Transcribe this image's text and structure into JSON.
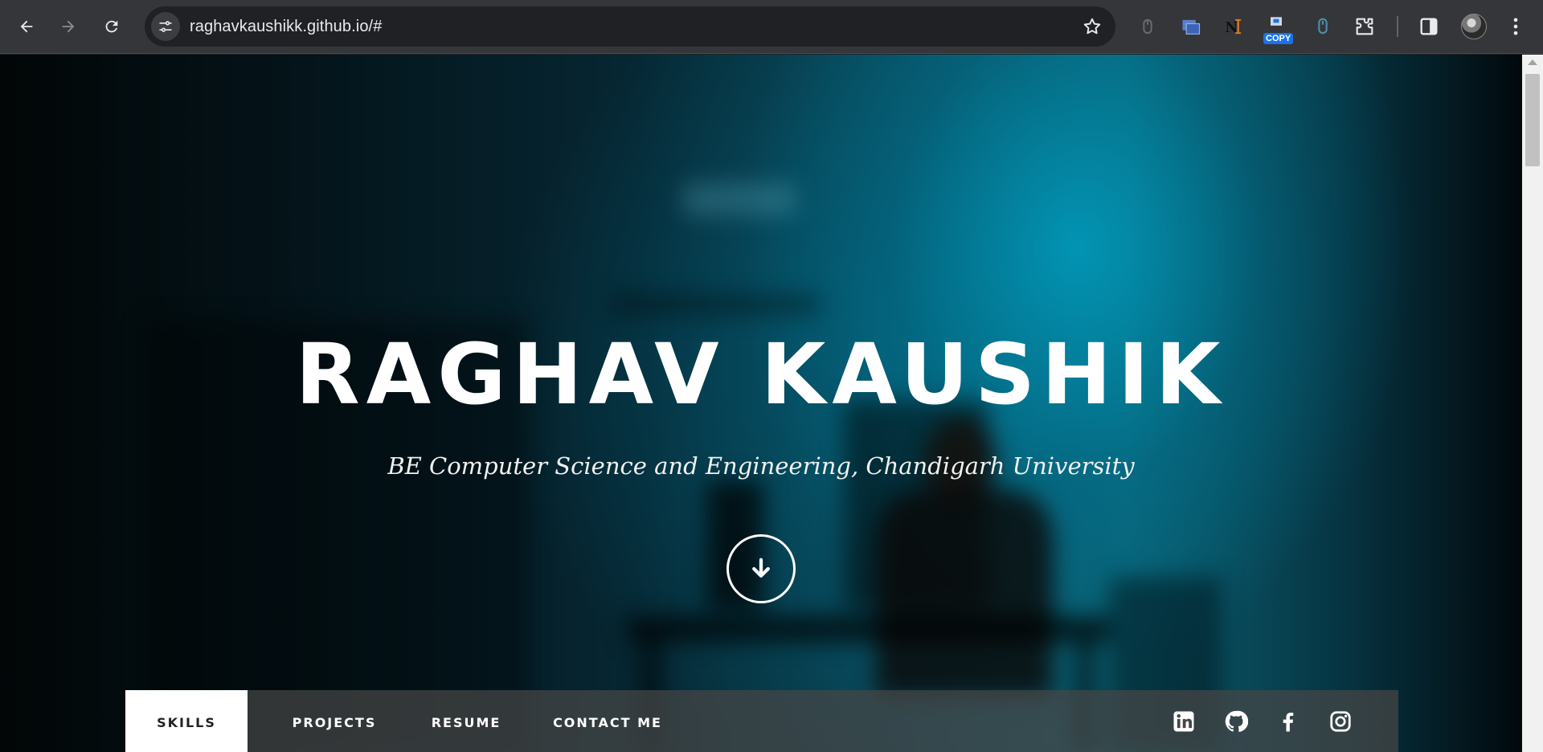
{
  "browser": {
    "url": "raghavkaushikk.github.io/#",
    "extensions": [
      {
        "name": "mouse-extension-icon"
      },
      {
        "name": "window-extension-icon"
      },
      {
        "name": "ni-extension-icon"
      },
      {
        "name": "copy-extension-icon",
        "badge": "COPY"
      },
      {
        "name": "mouse-outline-extension-icon"
      }
    ],
    "accent": "#1a73e8"
  },
  "hero": {
    "title": "RAGHAV KAUSHIK",
    "subtitle": "BE Computer Science and Engineering, Chandigarh University",
    "scroll_icon": "arrow-down-icon"
  },
  "nav": {
    "items": [
      {
        "label": "SKILLS",
        "active": true
      },
      {
        "label": "PROJECTS",
        "active": false
      },
      {
        "label": "RESUME",
        "active": false
      },
      {
        "label": "CONTACT ME",
        "active": false
      }
    ],
    "social": [
      "linkedin-icon",
      "github-icon",
      "facebook-icon",
      "instagram-icon"
    ]
  }
}
